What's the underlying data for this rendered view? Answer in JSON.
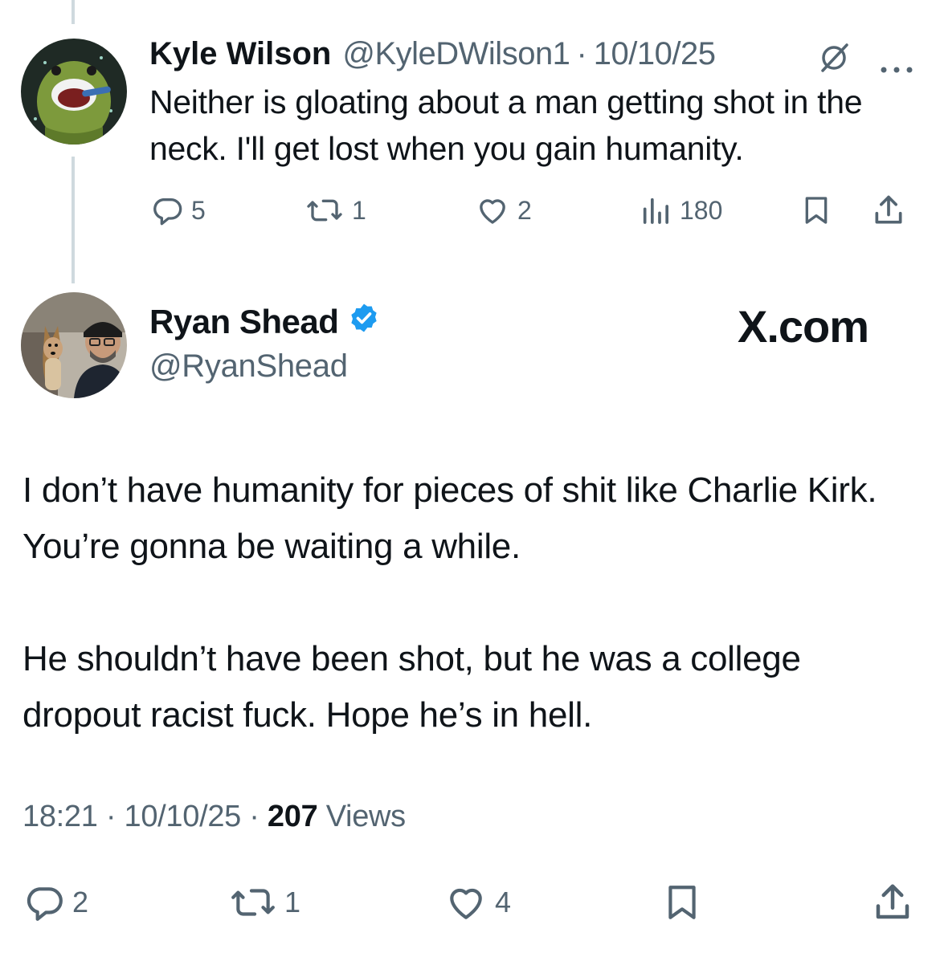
{
  "tweet1": {
    "author_name": "Kyle Wilson",
    "handle": "@KyleDWilson1",
    "separator": "·",
    "date": "10/10/25",
    "text": "Neither is gloating about a man getting shot in the neck. I'll get lost when you gain humanity.",
    "replies": "5",
    "reposts": "1",
    "likes": "2",
    "views": "180"
  },
  "tweet2": {
    "author_name": "Ryan Shead",
    "handle": "@RyanShead",
    "watermark": "X.com",
    "paragraph1": "I don’t have humanity for pieces of shit like Charlie Kirk. You’re gonna be waiting a while.",
    "paragraph2": "He shouldn’t have been shot, but he was a college dropout racist fuck. Hope he’s in hell.",
    "time": "18:21",
    "date": "10/10/25",
    "separator": "·",
    "views_count": "207",
    "views_label": "Views",
    "replies": "2",
    "reposts": "1",
    "likes": "4"
  },
  "icons": {
    "reply": "reply-icon",
    "repost": "repost-icon",
    "like": "heart-icon",
    "views": "views-icon",
    "bookmark": "bookmark-icon",
    "share": "share-icon",
    "grok": "grok-icon",
    "more": "more-icon",
    "verified": "verified-badge-icon"
  },
  "colors": {
    "text_primary": "#0f1419",
    "text_secondary": "#536471",
    "verified_blue": "#1d9bf0",
    "thread_line": "#cfd9de"
  }
}
